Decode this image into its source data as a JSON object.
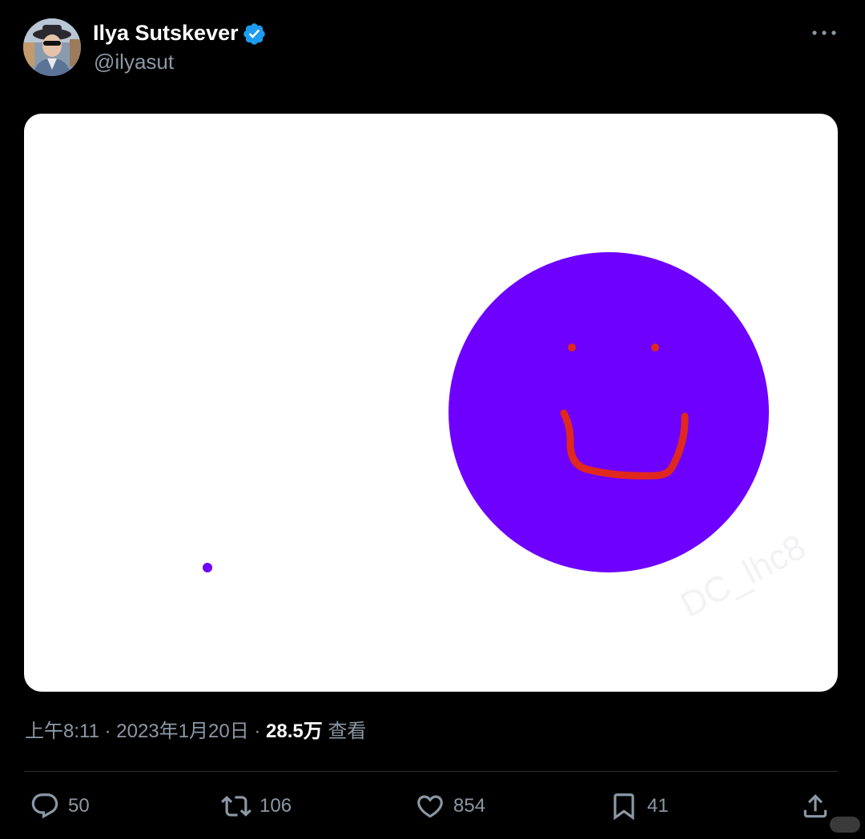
{
  "author": {
    "display_name": "Ilya Sutskever",
    "handle": "@ilyasut",
    "verified_color": "#1d9bf0"
  },
  "icons": {
    "verified": "verified-badge-icon",
    "more": "more-options-icon",
    "reply": "reply-icon",
    "retweet": "retweet-icon",
    "like": "like-icon",
    "bookmark": "bookmark-icon",
    "share": "share-icon"
  },
  "media": {
    "background": "#ffffff",
    "circle_color": "#6e00ff",
    "face_color": "#e0281e"
  },
  "meta": {
    "time": "上午8:11",
    "separator": " · ",
    "date": "2023年1月20日",
    "views_count": "28.5万",
    "views_label": " 查看"
  },
  "actions": {
    "replies": "50",
    "retweets": "106",
    "likes": "854",
    "bookmarks": "41"
  }
}
